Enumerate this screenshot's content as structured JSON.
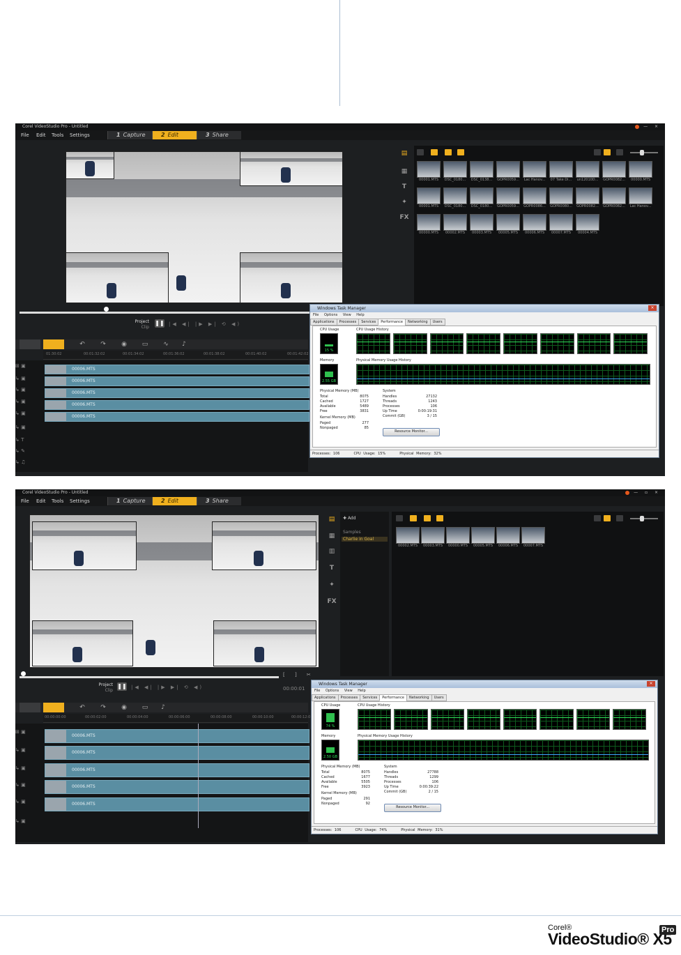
{
  "app": {
    "title": "Corel VideoStudio Pro - Untitled",
    "menu": [
      "File",
      "Edit",
      "Tools",
      "Settings"
    ],
    "steps": [
      {
        "num": "1",
        "label": "Capture"
      },
      {
        "num": "2",
        "label": "Edit"
      },
      {
        "num": "3",
        "label": "Share"
      }
    ],
    "accent": "#f0b01e"
  },
  "player": {
    "project_label": "Project",
    "clip_label": "Clip",
    "play_glyph": "❚❚",
    "controls": "|◀ ◀| |▶ ▶| ⟲ ◀)"
  },
  "shot1": {
    "ruler": [
      "01:30:02",
      "00:01:32:02",
      "00:01:34:02",
      "00:01:36:02",
      "00:01:38:02",
      "00:01:40:02",
      "00:01:42:02"
    ],
    "clips": [
      "00006.MTS",
      "00006.MTS",
      "00006.MTS",
      "00006.MTS",
      "00006.MTS"
    ],
    "library": [
      "00001.MTS",
      "DSC_0180...",
      "DSC_0138...",
      "GOPR0059...",
      "Lac Hanov...",
      "07 Take Di...",
      "un12010D...",
      "GOPR0082...",
      "00000.MTS",
      "00001.MTS",
      "DSC_0180...",
      "DSC_0180...",
      "GOPR0059...",
      "GOPR0086...",
      "GOPR0080...",
      "GOPR0082...",
      "GOPR0082...",
      "Lac Hanov...",
      "00000.MTS",
      "00002.MTS",
      "00003.MTS",
      "00005.MTS",
      "00006.MTS",
      "00007.MTS",
      "00004.MTS"
    ],
    "taskman": {
      "title": "Windows Task Manager",
      "menu": "File  Options  View  Help",
      "tabs": [
        "Applications",
        "Processes",
        "Services",
        "Performance",
        "Networking",
        "Users"
      ],
      "cpu_label": "CPU Usage",
      "cpu_value": "15 %",
      "cpu_hist_label": "CPU Usage History",
      "mem_label": "Memory",
      "mem_value": "2.55 GB",
      "mem_hist_label": "Physical Memory Usage History",
      "physical_title": "Physical Memory (MB)",
      "physical": [
        [
          "Total",
          "8075"
        ],
        [
          "Cached",
          "1727"
        ],
        [
          "Available",
          "5489"
        ],
        [
          "Free",
          "3831"
        ]
      ],
      "kernel_title": "Kernel Memory (MB)",
      "kernel": [
        [
          "Paged",
          "277"
        ],
        [
          "Nonpaged",
          "85"
        ]
      ],
      "system_title": "System",
      "system": [
        [
          "Handles",
          "27132"
        ],
        [
          "Threads",
          "1243"
        ],
        [
          "Processes",
          "106"
        ],
        [
          "Up Time",
          "0:00:19:31"
        ],
        [
          "Commit (GB)",
          "3 / 15"
        ]
      ],
      "resmon": "Resource Monitor...",
      "status": [
        "Processes: 106",
        "CPU Usage: 15%",
        "Physical Memory: 32%"
      ]
    }
  },
  "shot2": {
    "ruler": [
      "00:00:00:00",
      "00:00:02:00",
      "00:00:04:00",
      "00:00:06:00",
      "00:00:08:00",
      "00:00:10:00",
      "00:00:12:0"
    ],
    "timecode": "00:00:01",
    "clips": [
      "00006.MTS",
      "00006.MTS",
      "00006.MTS",
      "00006.MTS",
      "00006.MTS"
    ],
    "lib_add": "Add",
    "lib_items": [
      "Samples",
      "Charlie in Goal"
    ],
    "library": [
      "00002.MTS",
      "00003.MTS",
      "00000.MTS",
      "00005.MTS",
      "00006.MTS",
      "00007.MTS"
    ],
    "taskman": {
      "title": "Windows Task Manager",
      "menu": "File  Options  View  Help",
      "tabs": [
        "Applications",
        "Processes",
        "Services",
        "Performance",
        "Networking",
        "Users"
      ],
      "cpu_label": "CPU Usage",
      "cpu_value": "74 %",
      "cpu_hist_label": "CPU Usage History",
      "mem_label": "Memory",
      "mem_value": "2.50 GB",
      "mem_hist_label": "Physical Memory Usage History",
      "physical_title": "Physical Memory (MB)",
      "physical": [
        [
          "Total",
          "8075"
        ],
        [
          "Cached",
          "1677"
        ],
        [
          "Available",
          "5505"
        ],
        [
          "Free",
          "3923"
        ]
      ],
      "kernel_title": "Kernel Memory (MB)",
      "kernel": [
        [
          "Paged",
          "291"
        ],
        [
          "Nonpaged",
          "92"
        ]
      ],
      "system_title": "System",
      "system": [
        [
          "Handles",
          "27788"
        ],
        [
          "Threads",
          "1299"
        ],
        [
          "Processes",
          "106"
        ],
        [
          "Up Time",
          "0:00:39:22"
        ],
        [
          "Commit (GB)",
          "2 / 15"
        ]
      ],
      "resmon": "Resource Monitor...",
      "status": [
        "Processes: 106",
        "CPU Usage: 74%",
        "Physical Memory: 31%"
      ]
    }
  },
  "brand": {
    "corel": "Corel®",
    "name": "VideoStudio® X5",
    "pro": "Pro"
  }
}
